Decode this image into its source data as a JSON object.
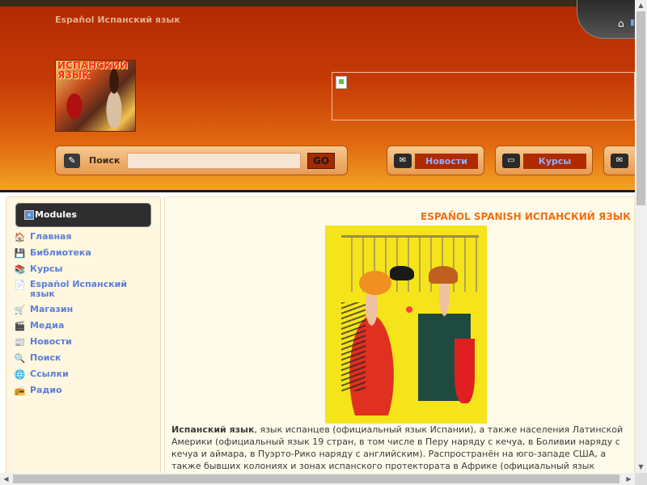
{
  "header": {
    "site_title": "Espaňol Испанский язык",
    "logo_text": "ИСПАНСКИЙ ЯЗЫК",
    "home_icon": "home-icon"
  },
  "search": {
    "label": "Поиск",
    "value": "",
    "go_label": "GO",
    "icon": "search-icon"
  },
  "nav": [
    {
      "label": "Новости",
      "icon": "news-icon"
    },
    {
      "label": "Курсы",
      "icon": "monitor-icon"
    },
    {
      "label": "",
      "icon": "chat-icon"
    }
  ],
  "sidebar": {
    "title": "Modules",
    "items": [
      {
        "label": "Главная",
        "icon": "home-icon"
      },
      {
        "label": "Библиотека",
        "icon": "disk-icon"
      },
      {
        "label": "Курсы",
        "icon": "books-icon"
      },
      {
        "label": "Español Испанский язык",
        "icon": "document-icon"
      },
      {
        "label": "Магазин",
        "icon": "shop-icon"
      },
      {
        "label": "Медиа",
        "icon": "media-icon"
      },
      {
        "label": "Новости",
        "icon": "news-icon"
      },
      {
        "label": "Поиск",
        "icon": "search-icon"
      },
      {
        "label": "Ссылки",
        "icon": "globe-icon"
      },
      {
        "label": "Радио",
        "icon": "radio-icon"
      }
    ]
  },
  "main": {
    "heading": "ESPAÑOL SPANISH ИСПАНСКИЙ ЯЗЫК",
    "intro_bold": "Испанский язык",
    "intro_text": ", язык испанцев (официальный язык Испании), а также населения Латинской Америки (официальный язык 19 стран, в том числе в Перу наряду с кечуа, в Боливии наряду с кечуа и аймара, в Пуэрто-Рико наряду с английским). Распространён на юго-западе США, а также бывших колониях и зонах испанского протектората в Африке (официальный язык Экваториальной Гвинеи)..."
  },
  "colors": {
    "accent": "#f07010",
    "header_dark": "#b32a04",
    "link": "#5a7fd8"
  }
}
